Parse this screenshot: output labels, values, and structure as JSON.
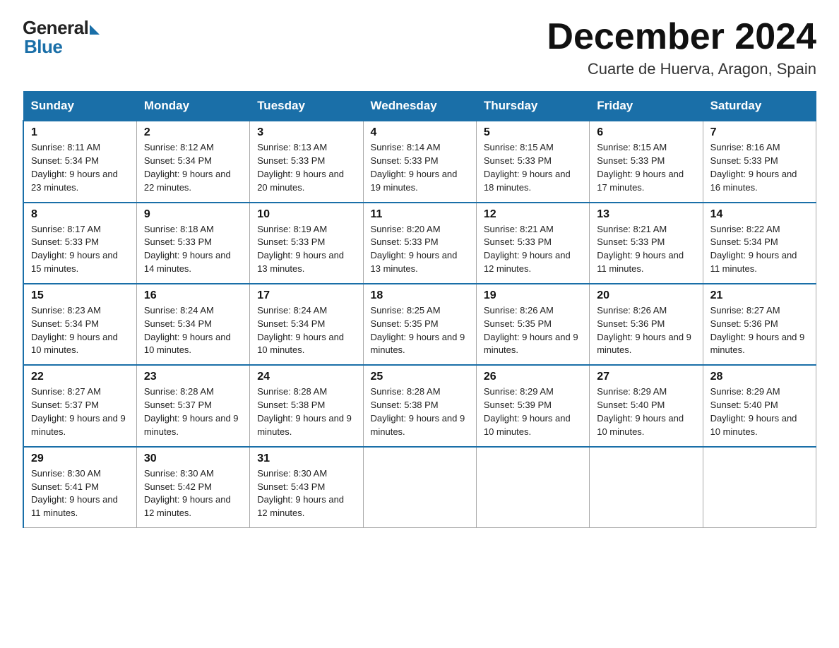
{
  "header": {
    "logo_general": "General",
    "logo_blue": "Blue",
    "month_title": "December 2024",
    "location": "Cuarte de Huerva, Aragon, Spain"
  },
  "days_of_week": [
    "Sunday",
    "Monday",
    "Tuesday",
    "Wednesday",
    "Thursday",
    "Friday",
    "Saturday"
  ],
  "weeks": [
    [
      {
        "day": "1",
        "sunrise": "Sunrise: 8:11 AM",
        "sunset": "Sunset: 5:34 PM",
        "daylight": "Daylight: 9 hours and 23 minutes."
      },
      {
        "day": "2",
        "sunrise": "Sunrise: 8:12 AM",
        "sunset": "Sunset: 5:34 PM",
        "daylight": "Daylight: 9 hours and 22 minutes."
      },
      {
        "day": "3",
        "sunrise": "Sunrise: 8:13 AM",
        "sunset": "Sunset: 5:33 PM",
        "daylight": "Daylight: 9 hours and 20 minutes."
      },
      {
        "day": "4",
        "sunrise": "Sunrise: 8:14 AM",
        "sunset": "Sunset: 5:33 PM",
        "daylight": "Daylight: 9 hours and 19 minutes."
      },
      {
        "day": "5",
        "sunrise": "Sunrise: 8:15 AM",
        "sunset": "Sunset: 5:33 PM",
        "daylight": "Daylight: 9 hours and 18 minutes."
      },
      {
        "day": "6",
        "sunrise": "Sunrise: 8:15 AM",
        "sunset": "Sunset: 5:33 PM",
        "daylight": "Daylight: 9 hours and 17 minutes."
      },
      {
        "day": "7",
        "sunrise": "Sunrise: 8:16 AM",
        "sunset": "Sunset: 5:33 PM",
        "daylight": "Daylight: 9 hours and 16 minutes."
      }
    ],
    [
      {
        "day": "8",
        "sunrise": "Sunrise: 8:17 AM",
        "sunset": "Sunset: 5:33 PM",
        "daylight": "Daylight: 9 hours and 15 minutes."
      },
      {
        "day": "9",
        "sunrise": "Sunrise: 8:18 AM",
        "sunset": "Sunset: 5:33 PM",
        "daylight": "Daylight: 9 hours and 14 minutes."
      },
      {
        "day": "10",
        "sunrise": "Sunrise: 8:19 AM",
        "sunset": "Sunset: 5:33 PM",
        "daylight": "Daylight: 9 hours and 13 minutes."
      },
      {
        "day": "11",
        "sunrise": "Sunrise: 8:20 AM",
        "sunset": "Sunset: 5:33 PM",
        "daylight": "Daylight: 9 hours and 13 minutes."
      },
      {
        "day": "12",
        "sunrise": "Sunrise: 8:21 AM",
        "sunset": "Sunset: 5:33 PM",
        "daylight": "Daylight: 9 hours and 12 minutes."
      },
      {
        "day": "13",
        "sunrise": "Sunrise: 8:21 AM",
        "sunset": "Sunset: 5:33 PM",
        "daylight": "Daylight: 9 hours and 11 minutes."
      },
      {
        "day": "14",
        "sunrise": "Sunrise: 8:22 AM",
        "sunset": "Sunset: 5:34 PM",
        "daylight": "Daylight: 9 hours and 11 minutes."
      }
    ],
    [
      {
        "day": "15",
        "sunrise": "Sunrise: 8:23 AM",
        "sunset": "Sunset: 5:34 PM",
        "daylight": "Daylight: 9 hours and 10 minutes."
      },
      {
        "day": "16",
        "sunrise": "Sunrise: 8:24 AM",
        "sunset": "Sunset: 5:34 PM",
        "daylight": "Daylight: 9 hours and 10 minutes."
      },
      {
        "day": "17",
        "sunrise": "Sunrise: 8:24 AM",
        "sunset": "Sunset: 5:34 PM",
        "daylight": "Daylight: 9 hours and 10 minutes."
      },
      {
        "day": "18",
        "sunrise": "Sunrise: 8:25 AM",
        "sunset": "Sunset: 5:35 PM",
        "daylight": "Daylight: 9 hours and 9 minutes."
      },
      {
        "day": "19",
        "sunrise": "Sunrise: 8:26 AM",
        "sunset": "Sunset: 5:35 PM",
        "daylight": "Daylight: 9 hours and 9 minutes."
      },
      {
        "day": "20",
        "sunrise": "Sunrise: 8:26 AM",
        "sunset": "Sunset: 5:36 PM",
        "daylight": "Daylight: 9 hours and 9 minutes."
      },
      {
        "day": "21",
        "sunrise": "Sunrise: 8:27 AM",
        "sunset": "Sunset: 5:36 PM",
        "daylight": "Daylight: 9 hours and 9 minutes."
      }
    ],
    [
      {
        "day": "22",
        "sunrise": "Sunrise: 8:27 AM",
        "sunset": "Sunset: 5:37 PM",
        "daylight": "Daylight: 9 hours and 9 minutes."
      },
      {
        "day": "23",
        "sunrise": "Sunrise: 8:28 AM",
        "sunset": "Sunset: 5:37 PM",
        "daylight": "Daylight: 9 hours and 9 minutes."
      },
      {
        "day": "24",
        "sunrise": "Sunrise: 8:28 AM",
        "sunset": "Sunset: 5:38 PM",
        "daylight": "Daylight: 9 hours and 9 minutes."
      },
      {
        "day": "25",
        "sunrise": "Sunrise: 8:28 AM",
        "sunset": "Sunset: 5:38 PM",
        "daylight": "Daylight: 9 hours and 9 minutes."
      },
      {
        "day": "26",
        "sunrise": "Sunrise: 8:29 AM",
        "sunset": "Sunset: 5:39 PM",
        "daylight": "Daylight: 9 hours and 10 minutes."
      },
      {
        "day": "27",
        "sunrise": "Sunrise: 8:29 AM",
        "sunset": "Sunset: 5:40 PM",
        "daylight": "Daylight: 9 hours and 10 minutes."
      },
      {
        "day": "28",
        "sunrise": "Sunrise: 8:29 AM",
        "sunset": "Sunset: 5:40 PM",
        "daylight": "Daylight: 9 hours and 10 minutes."
      }
    ],
    [
      {
        "day": "29",
        "sunrise": "Sunrise: 8:30 AM",
        "sunset": "Sunset: 5:41 PM",
        "daylight": "Daylight: 9 hours and 11 minutes."
      },
      {
        "day": "30",
        "sunrise": "Sunrise: 8:30 AM",
        "sunset": "Sunset: 5:42 PM",
        "daylight": "Daylight: 9 hours and 12 minutes."
      },
      {
        "day": "31",
        "sunrise": "Sunrise: 8:30 AM",
        "sunset": "Sunset: 5:43 PM",
        "daylight": "Daylight: 9 hours and 12 minutes."
      },
      null,
      null,
      null,
      null
    ]
  ]
}
